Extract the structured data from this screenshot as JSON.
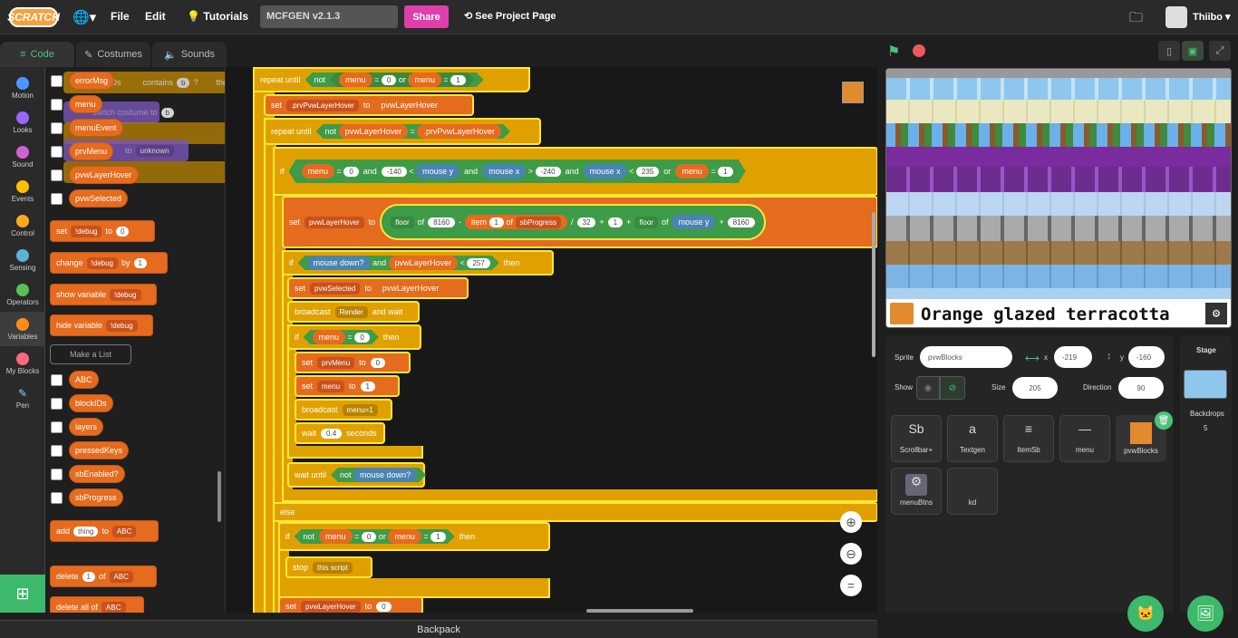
{
  "topbar": {
    "logo": "SCRATCH",
    "file": "File",
    "edit": "Edit",
    "tutorials": "Tutorials",
    "project_title": "MCFGEN v2.1.3",
    "share": "Share",
    "see_project": "See Project Page",
    "username": "Thiibo"
  },
  "tabs": {
    "code": "Code",
    "costumes": "Costumes",
    "sounds": "Sounds"
  },
  "categories": [
    {
      "label": "Motion",
      "color": "#4c97ff"
    },
    {
      "label": "Looks",
      "color": "#9966ff"
    },
    {
      "label": "Sound",
      "color": "#cf63cf"
    },
    {
      "label": "Events",
      "color": "#ffbf00"
    },
    {
      "label": "Control",
      "color": "#ffab19"
    },
    {
      "label": "Sensing",
      "color": "#5cb1d6"
    },
    {
      "label": "Operators",
      "color": "#59c059"
    },
    {
      "label": "Variables",
      "color": "#ff8c1a"
    },
    {
      "label": "My Blocks",
      "color": "#ff6680"
    },
    {
      "label": "Pen",
      "color": "#0fbd8c"
    }
  ],
  "palette": {
    "vars": [
      "errorMsg",
      "menu",
      "menuEvent",
      "prvMenu",
      "pvwLayerHover",
      "pvwSelected"
    ],
    "ghost": {
      "contains": "contains",
      "b": "b",
      "q": "?",
      "then": "then",
      "costume_to": "switch costume to",
      "set_to": "set",
      "to_unknown": "to",
      "unknown": "unknown",
      "ids": "IDs"
    },
    "set": "set",
    "debug": "!debug",
    "to": "to",
    "val0": "0",
    "change": "change",
    "by": "by",
    "val1": "1",
    "show": "show variable",
    "hide": "hide variable",
    "make_list": "Make a List",
    "lists": [
      "ABC",
      "blockIDs",
      "layers",
      "pressedKeys",
      "sbEnabled?",
      "sbProgress"
    ],
    "add": "add",
    "thing": "thing",
    "list": "ABC",
    "delete": "delete",
    "of": "of",
    "delete_all": "delete all of"
  },
  "script": {
    "repeat_until": "repeat until",
    "not": "not",
    "menu": "menu",
    "eq": "=",
    "or": "or",
    "and": "and",
    "zero": "0",
    "one": "1",
    "set": "set",
    "to": "to",
    "prvPvwLayerHover": ".prvPvwLayerHover",
    "pvwLayerHover": "pvwLayerHover",
    "if": "if",
    "then": "then",
    "else": "else",
    "n140": "-140",
    "lt": "<",
    "gt": ">",
    "mouse_y": "mouse y",
    "mouse_x": "mouse x",
    "n240": "-240",
    "v235": "235",
    "floor": "floor",
    "of": "of",
    "v8160": "8160",
    "minus": "-",
    "item": "item",
    "sbProgress": "sbProgress",
    "div": "/",
    "v32": "32",
    "plus": "+",
    "mouse_down": "mouse down?",
    "v257": "257",
    "pvwSelected": "pvwSelected",
    "broadcast": "broadcast",
    "render": "Render",
    "and_wait": "and wait",
    "prvMenu": "prvMenu",
    "menu_eq1": "menu=1",
    "wait": "wait",
    "v04": "0.4",
    "seconds": "seconds",
    "wait_until": "wait until",
    "stop": "stop",
    "this_script": "this script"
  },
  "stage": {
    "caption": "Orange glazed terracotta"
  },
  "sprite_info": {
    "sprite_label": "Sprite",
    "sprite_name": "pvwBlocks",
    "x_label": "x",
    "x": "-219",
    "y_label": "y",
    "y": "-160",
    "show_label": "Show",
    "size_label": "Size",
    "size": "205",
    "direction_label": "Direction",
    "direction": "90"
  },
  "sprites": [
    {
      "name": "Scrollbar+",
      "thumb": "Sb"
    },
    {
      "name": "Textgen",
      "thumb": "a"
    },
    {
      "name": "ItemSb",
      "thumb": "≡"
    },
    {
      "name": "menu",
      "thumb": "—"
    },
    {
      "name": "pvwBlocks",
      "thumb": "■"
    },
    {
      "name": "menuBtns",
      "thumb": "⚙"
    },
    {
      "name": "kd",
      "thumb": ""
    }
  ],
  "stage_panel": {
    "title": "Stage",
    "backdrops": "Backdrops",
    "count": "5"
  },
  "backpack": "Backpack"
}
